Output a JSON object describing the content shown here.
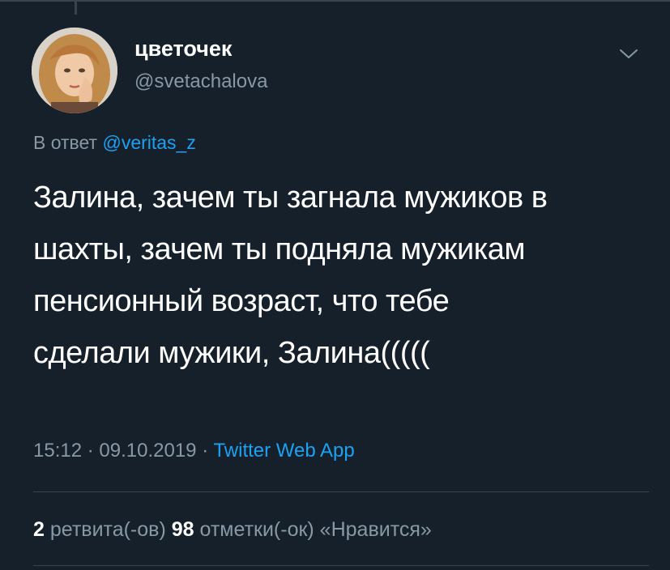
{
  "tweet": {
    "author": {
      "display_name": "цветочек",
      "handle": "@svetachalova"
    },
    "reply": {
      "prefix": "В ответ",
      "mention": "@veritas_z"
    },
    "text_lines": [
      "Залина, зачем ты загнала мужиков в",
      "шахты, зачем ты подняла мужикам",
      "пенсионный возраст, что тебе",
      "сделали мужики, Залина((((("
    ],
    "time": "15:12",
    "date": "09.10.2019",
    "separator": "·",
    "source": "Twitter Web App",
    "retweets": {
      "count": "2",
      "label": "ретвита(-ов)"
    },
    "likes": {
      "count": "98",
      "label": "отметки(-ок) «Нравится»"
    }
  },
  "icons": {
    "menu": "chevron-down-icon",
    "avatar": "avatar-photo"
  },
  "colors": {
    "background": "#15202b",
    "text_primary": "#ffffff",
    "text_secondary": "#8899a6",
    "accent": "#1da1f2",
    "divider": "#38444d"
  }
}
